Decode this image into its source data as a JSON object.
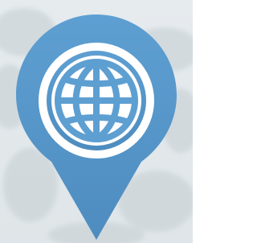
{
  "map_marker": {
    "icon": "globe-icon",
    "tooltip": "",
    "colors": {
      "pin": "#5e9fd2",
      "pin_shadow": "#4e8cbf",
      "icon_fg": "#ffffff",
      "background_top": "#e6ebee",
      "background_bottom": "#dfe5e8",
      "foliage": "#c9d2d6"
    }
  }
}
